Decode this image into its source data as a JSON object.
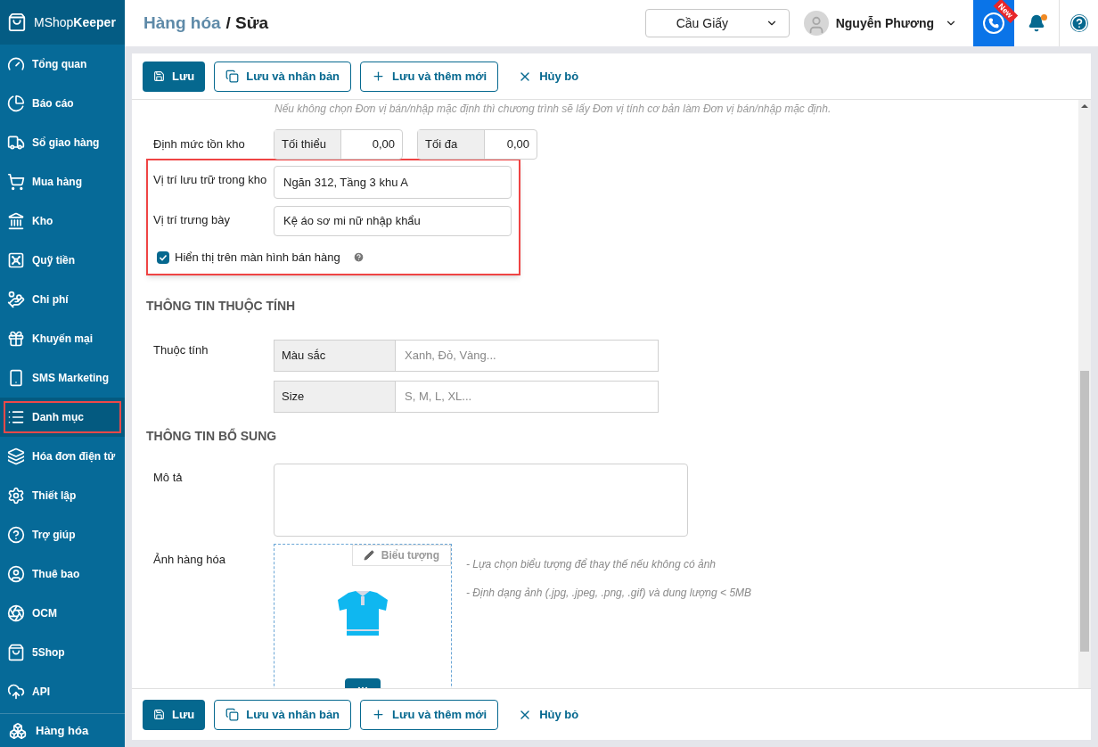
{
  "logo": {
    "light": "MShop",
    "bold": "Keeper"
  },
  "sidebar": {
    "items": [
      {
        "label": "Tổng quan",
        "selected": false
      },
      {
        "label": "Báo cáo",
        "selected": false
      },
      {
        "label": "Sổ giao hàng",
        "selected": false
      },
      {
        "label": "Mua hàng",
        "selected": false
      },
      {
        "label": "Kho",
        "selected": false
      },
      {
        "label": "Quỹ tiền",
        "selected": false
      },
      {
        "label": "Chi phí",
        "selected": false
      },
      {
        "label": "Khuyến mại",
        "selected": false
      },
      {
        "label": "SMS Marketing",
        "selected": false
      },
      {
        "label": "Danh mục",
        "selected": true
      },
      {
        "label": "Hóa đơn điện tử",
        "selected": false
      },
      {
        "label": "Thiết lập",
        "selected": false
      },
      {
        "label": "Trợ giúp",
        "selected": false
      },
      {
        "label": "Thuê bao",
        "selected": false
      },
      {
        "label": "OCM",
        "selected": false
      },
      {
        "label": "5Shop",
        "selected": false
      },
      {
        "label": "API",
        "selected": false
      }
    ],
    "footer_item": "Hàng hóa"
  },
  "header": {
    "parent": "Hàng hóa",
    "current": "/ Sửa",
    "branch": "Cầu Giấy",
    "user": "Nguyễn Phương",
    "badge": "New"
  },
  "toolbar_top": [
    {
      "label": "Lưu",
      "kind": "primary"
    },
    {
      "label": "Lưu và nhân bản",
      "kind": "duplicate"
    },
    {
      "label": "Lưu và thêm mới",
      "kind": "add"
    },
    {
      "label": "Hủy bỏ",
      "kind": "cancel"
    }
  ],
  "form": {
    "hint": "Nếu không chọn Đơn vị bán/nhập mặc định thì chương trình sẽ lấy Đơn vị tính cơ bản làm Đơn vị bán/nhập mặc định.",
    "stock_limit": {
      "label": "Định mức tồn kho",
      "min_label": "Tối thiểu",
      "min_value": "0,00",
      "max_label": "Tối đa",
      "max_value": "0,00"
    },
    "storage": {
      "label": "Vị trí lưu trữ trong kho",
      "value": "Ngăn 312, Tầng 3 khu A"
    },
    "display": {
      "label": "Vị trí trưng bày",
      "value": "Kệ áo sơ mi nữ nhập khẩu"
    },
    "show_on_sales": {
      "label": "Hiển thị trên màn hình bán hàng",
      "checked": true
    },
    "attributes_title": "THÔNG TIN THUỘC TÍNH",
    "attributes_label": "Thuộc tính",
    "attributes": [
      {
        "name": "Màu sắc",
        "placeholder": "Xanh, Đỏ, Vàng..."
      },
      {
        "name": "Size",
        "placeholder": "S, M, L, XL..."
      }
    ],
    "extra_title": "THÔNG TIN BỔ SUNG",
    "description_label": "Mô tả",
    "image_label": "Ảnh hàng hóa",
    "icon_button": "Biểu tượng",
    "image_notes": [
      "- Lựa chọn biểu tượng để thay thế nếu không có ảnh",
      "- Định dạng ảnh (.jpg, .jpeg, .png, .gif) và dung lượng < 5MB"
    ]
  },
  "toolbar_bottom": [
    {
      "label": "Lưu",
      "kind": "primary"
    },
    {
      "label": "Lưu và nhân bản",
      "kind": "duplicate"
    },
    {
      "label": "Lưu và thêm mới",
      "kind": "add"
    },
    {
      "label": "Hủy bỏ",
      "kind": "cancel"
    }
  ]
}
